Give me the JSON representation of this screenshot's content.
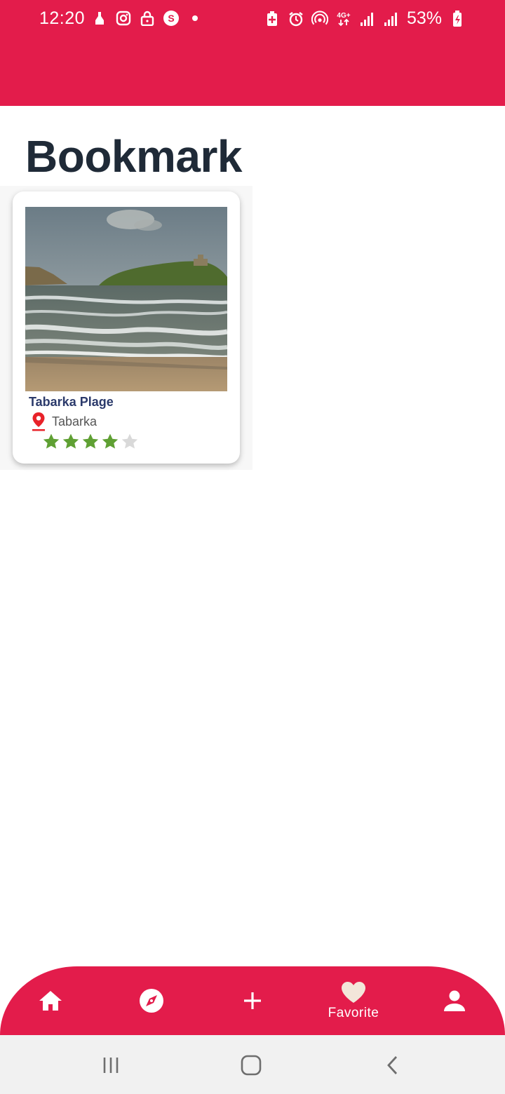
{
  "status_bar": {
    "time": "12:20",
    "battery": "53%",
    "left_icons": [
      "cleaning-icon",
      "instagram-icon",
      "lock-icon",
      "s-app-icon",
      "dot-icon"
    ],
    "right_icons": [
      "battery-saver-icon",
      "alarm-icon",
      "hotspot-icon",
      "4g-icon",
      "signal-icon",
      "signal-icon",
      "battery-icon"
    ]
  },
  "page": {
    "title": "Bookmark"
  },
  "bookmarks": [
    {
      "title": "Tabarka Plage",
      "location": "Tabarka",
      "rating": 4,
      "max_rating": 5
    }
  ],
  "bottom_nav": {
    "items": [
      {
        "icon": "home-icon",
        "label": ""
      },
      {
        "icon": "compass-icon",
        "label": ""
      },
      {
        "icon": "plus-icon",
        "label": ""
      },
      {
        "icon": "heart-icon",
        "label": "Favorite"
      },
      {
        "icon": "person-icon",
        "label": ""
      }
    ],
    "active": "Favorite"
  },
  "colors": {
    "primary": "#E31C4B",
    "title": "#1F2A37",
    "card_title": "#2B3A6B",
    "star_filled": "#5FA033",
    "star_empty": "#D9D9D9",
    "pin": "#E82229"
  }
}
